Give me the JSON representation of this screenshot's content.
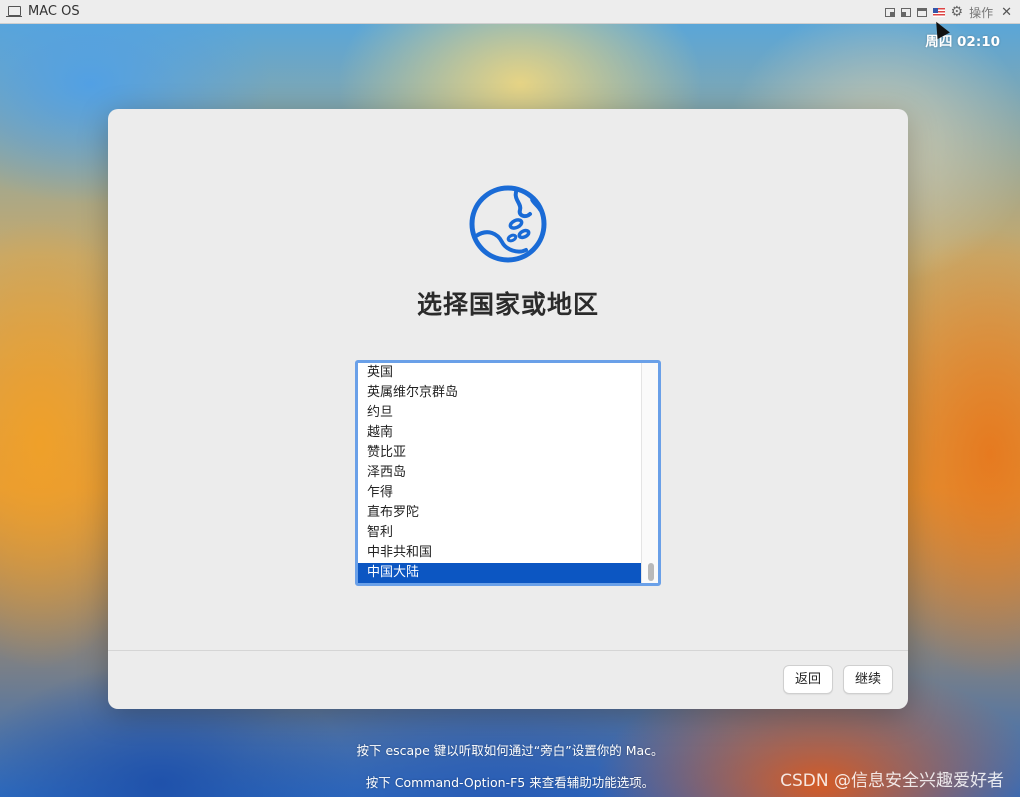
{
  "vm_window": {
    "title": "MAC OS",
    "actions_label": "操作",
    "close_glyph": "✕",
    "gear_glyph": "⚙"
  },
  "menubar": {
    "clock": "周四 02:10"
  },
  "setup": {
    "title": "选择国家或地区",
    "list_items": [
      "英国",
      "英属维尔京群岛",
      "约旦",
      "越南",
      "赞比亚",
      "泽西岛",
      "乍得",
      "直布罗陀",
      "智利",
      "中非共和国",
      "中国大陆"
    ],
    "selected_item": "中国大陆",
    "back_button": "返回",
    "continue_button": "继续"
  },
  "hints": {
    "line1": "按下 escape 键以听取如何通过“旁白”设置你的 Mac。",
    "line2": "按下 Command-Option-F5 来查看辅助功能选项。"
  },
  "watermark": "CSDN @信息安全兴趣爱好者",
  "colors": {
    "accent": "#0c56c2",
    "globe": "#1a6bd6",
    "panel": "#ececec"
  }
}
